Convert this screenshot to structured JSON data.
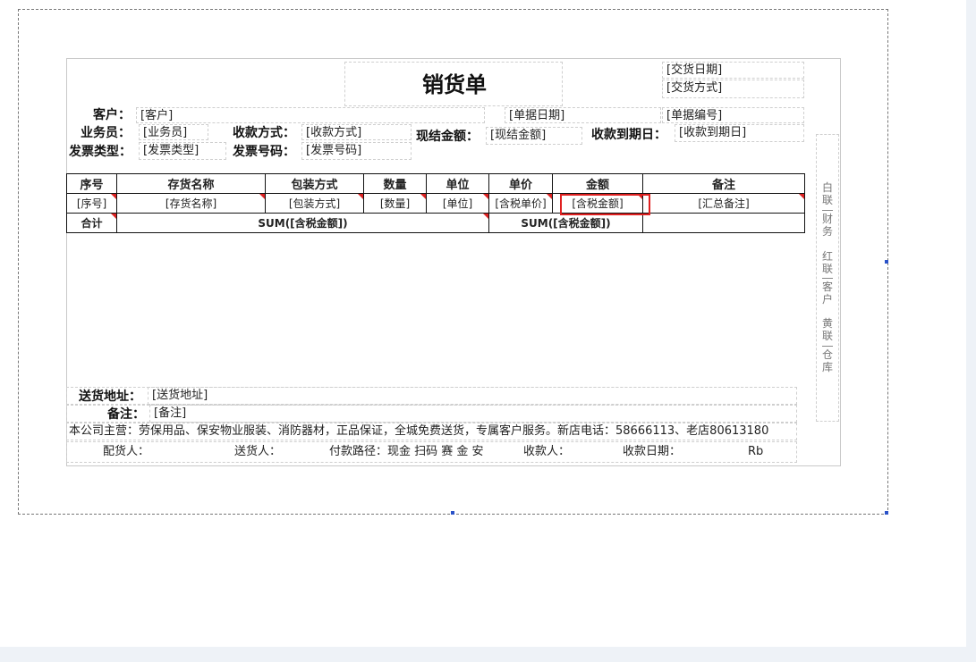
{
  "report": {
    "title": "销货单",
    "delivery_date": "[交货日期]",
    "delivery_method": "[交货方式]",
    "customer_label": "客户：",
    "customer_value": "[客户]",
    "doc_date": "[单据日期]",
    "doc_number": "[单据编号]",
    "salesman_label": "业务员：",
    "salesman_value": "[业务员]",
    "pay_method_label": "收款方式：",
    "pay_method_value": "[收款方式]",
    "cash_amount_label": "现结金额：",
    "cash_amount_value": "[现结金额]",
    "due_date_label": "收款到期日：",
    "due_date_value": "[收款到期日]",
    "invoice_type_label": "发票类型：",
    "invoice_type_value": "[发票类型]",
    "invoice_no_label": "发票号码：",
    "invoice_no_value": "[发票号码]"
  },
  "table": {
    "headers": [
      "序号",
      "存货名称",
      "包装方式",
      "数量",
      "单位",
      "单价",
      "金额",
      "备注"
    ],
    "row": [
      "[序号]",
      "[存货名称]",
      "[包装方式]",
      "[数量]",
      "[单位]",
      "[含税单价]",
      "[含税金额]",
      "[汇总备注]"
    ],
    "total_label": "合计",
    "total_sum1": "SUM([含税金额])",
    "total_sum2": "SUM([含税金额])"
  },
  "side_copies": {
    "white": "白联",
    "white_dest": "财务",
    "red": "红联",
    "red_dest": "客户",
    "yellow": "黄联",
    "yellow_dest": "仓库"
  },
  "footer": {
    "address_label": "送货地址：",
    "address_value": "[送货地址]",
    "remark_label": "备注：",
    "remark_value": "[备注]",
    "company_info": "本公司主营：劳保用品、保安物业服装、消防器材，正品保证，全城免费送货，专属客户服务。新店电话：58666113、老店80613180",
    "picker": "配货人：",
    "deliverer": "送货人：",
    "payment_path": "付款路径：现金 扫码 赛 金 安",
    "receiver": "收款人：",
    "receive_date": "收款日期：",
    "rb": "Rb"
  }
}
